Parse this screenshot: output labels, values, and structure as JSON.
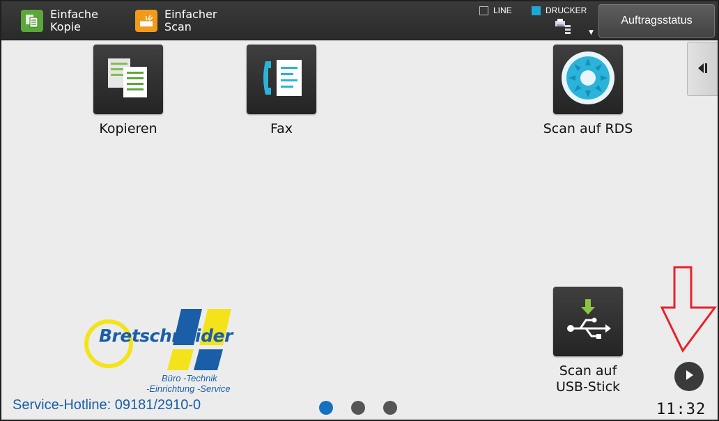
{
  "topbar": {
    "quick_copy_label": "Einfache Kopie",
    "quick_scan_label": "Einfacher Scan",
    "line_label": "LINE",
    "printer_label": "DRUCKER",
    "job_status_label": "Auftragsstatus"
  },
  "apps": {
    "kopieren": "Kopieren",
    "fax": "Fax",
    "scan_rds": "Scan auf RDS",
    "scan_usb_line1": "Scan auf",
    "scan_usb_line2": "USB-Stick"
  },
  "logo": {
    "brand": "Bretschneider",
    "tagline1": "Büro -Technik",
    "tagline2": "-Einrichtung -Service"
  },
  "footer": {
    "hotline": "Service-Hotline: 09181/2910-0",
    "clock": "11:32"
  },
  "pager": {
    "total": 3,
    "current": 1
  },
  "colors": {
    "brand_blue": "#1a5ea8",
    "logo_yellow": "#f4e31a",
    "accent_cyan": "#1ea7d8",
    "annotation_red": "#e8212a"
  },
  "icons": {
    "quick_copy": "copy-icon",
    "quick_scan": "scanner-icon",
    "printer_queue": "printer-queue-icon",
    "side_handle": "collapse-left-icon",
    "kopieren": "document-copy-icon",
    "fax": "fax-icon",
    "scan_rds": "disc-icon",
    "scan_usb": "usb-icon",
    "next_page": "play-icon",
    "annotation": "down-arrow-icon"
  }
}
